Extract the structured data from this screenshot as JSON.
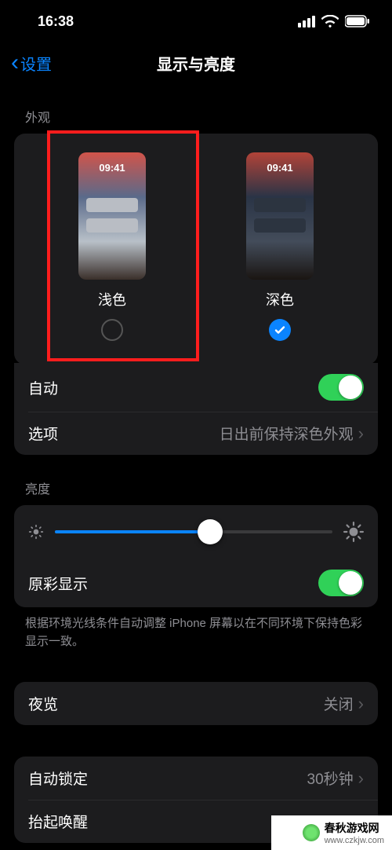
{
  "status": {
    "time": "16:38"
  },
  "nav": {
    "back": "设置",
    "title": "显示与亮度"
  },
  "appearance": {
    "header": "外观",
    "mock_time": "09:41",
    "light": {
      "label": "浅色",
      "selected": false
    },
    "dark": {
      "label": "深色",
      "selected": true
    }
  },
  "auto_row": {
    "title": "自动"
  },
  "options_row": {
    "title": "选项",
    "detail": "日出前保持深色外观"
  },
  "brightness": {
    "header": "亮度",
    "value_pct": 56
  },
  "true_tone": {
    "title": "原彩显示",
    "footer": "根据环境光线条件自动调整 iPhone 屏幕以在不同环境下保持色彩显示一致。"
  },
  "night_shift": {
    "title": "夜览",
    "detail": "关闭"
  },
  "auto_lock": {
    "title": "自动锁定",
    "detail": "30秒钟"
  },
  "raise_wake": {
    "title": "抬起唤醒"
  },
  "watermark": {
    "name": "春秋游戏网",
    "url": "www.czkjw.com"
  }
}
